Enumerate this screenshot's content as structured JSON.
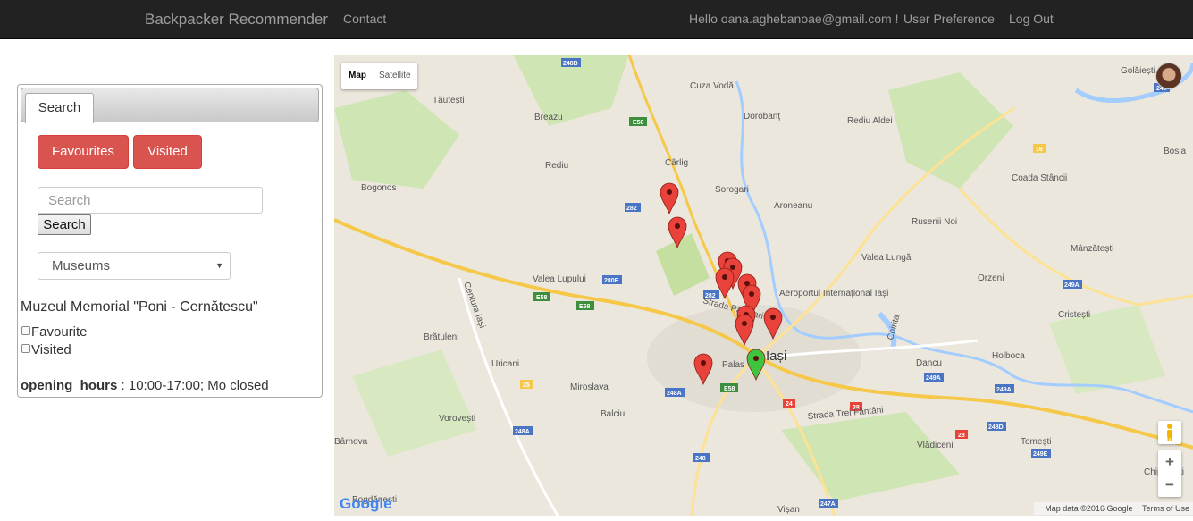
{
  "navbar": {
    "brand": "Backpacker Recommender",
    "contact": "Contact",
    "greeting": "Hello oana.aghebanoae@gmail.com !",
    "user_preference": "User Preference",
    "logout": "Log Out"
  },
  "panel": {
    "tab_label": "Search",
    "favourites_button": "Favourites",
    "visited_button": "Visited",
    "search_placeholder": "Search",
    "search_button": "Search",
    "category_selected": "Museums",
    "place_title": "Muzeul Memorial \"Poni - Cernătescu\"",
    "favourite_label": "Favourite",
    "visited_label": "Visited",
    "hours_key": "opening_hours",
    "hours_separator": " : ",
    "hours_value": "10:00-17:00; Mo closed"
  },
  "map": {
    "map_type_map": "Map",
    "map_type_satellite": "Satellite",
    "zoom_in": "+",
    "zoom_out": "−",
    "logo": "Google",
    "attribution": "Map data ©2016 Google",
    "terms": "Terms of Use",
    "places": [
      "Golăiești",
      "Tăutești",
      "Cuza Vodă",
      "Breazu",
      "Dorobanț",
      "Rediu Aldei",
      "Bosia",
      "Rediu",
      "Cârlig",
      "Coada Stâncii",
      "Bogonos",
      "Șorogari",
      "Aroneanu",
      "Rusenii Noi",
      "Mânzătești",
      "Valea Lupului",
      "Valea Lungă",
      "Orzeni",
      "Aeroportul Internațional Iași",
      "Cristești",
      "Brătuleni",
      "Iași",
      "Holboca",
      "Uricani",
      "Miroslava",
      "Palas",
      "Dancu",
      "Vorovești",
      "Balciu",
      "Vlădiceni",
      "Tomești",
      "Chiperești",
      "Bârnova",
      "Vișan",
      "Bogdănești",
      "Centura Iași",
      "Chirita",
      "Strada Trei Fântâni",
      "Strada Păcurari"
    ],
    "road_numbers": [
      "248B",
      "E58",
      "249",
      "16",
      "249A",
      "282",
      "280E",
      "E58",
      "282",
      "249A",
      "248A",
      "E58",
      "24",
      "28",
      "249A",
      "248A",
      "248",
      "248D",
      "249E",
      "247A",
      "25",
      "28",
      "E58"
    ],
    "marker_color_red": "#e8423a",
    "marker_color_green": "#3ec43e"
  }
}
